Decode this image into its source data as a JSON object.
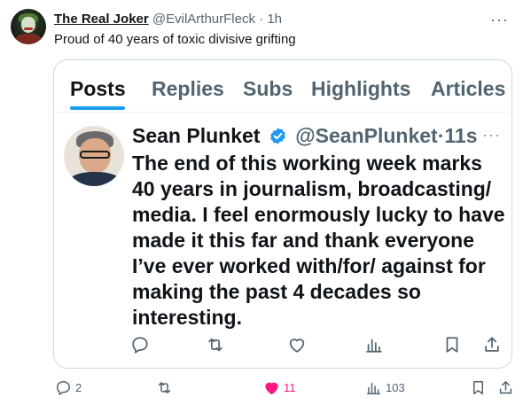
{
  "outer_tweet": {
    "display_name": "The Real Joker",
    "handle": "@EvilArthurFleck",
    "separator": "·",
    "time": "1h",
    "more": "···",
    "text": "Proud of 40 years of toxic divisive grifting",
    "actions": {
      "reply_count": "2",
      "like_count": "11",
      "like_active": true,
      "views_count": "103"
    }
  },
  "quoted": {
    "tabs": [
      {
        "label": "Posts",
        "active": true
      },
      {
        "label": "Replies",
        "active": false
      },
      {
        "label": "Subs",
        "active": false
      },
      {
        "label": "Highlights",
        "active": false
      },
      {
        "label": "Articles",
        "active": false
      }
    ],
    "tweet": {
      "display_name": "Sean Plunket",
      "verified": true,
      "handle": "@SeanPlunket",
      "separator": "·",
      "time": "11s",
      "more": "···",
      "text": "The end of this working week marks 40 years in journalism, broadcasting/ media. I feel enormously lucky to have made it this far and thank everyone I’ve ever worked with/for/ against for making the past 4 decades so interesting."
    }
  },
  "colors": {
    "accent": "#1d9bf0",
    "like": "#f91880",
    "text": "#0f1419",
    "secondary": "#536471",
    "border": "#cfd9de"
  },
  "icons": {
    "inner_actions": [
      "reply-icon",
      "retweet-icon",
      "like-icon",
      "views-icon",
      "bookmark-icon",
      "share-icon"
    ],
    "outer_actions": [
      "reply-icon",
      "retweet-icon",
      "like-icon",
      "views-icon",
      "bookmark-icon",
      "share-icon"
    ]
  }
}
